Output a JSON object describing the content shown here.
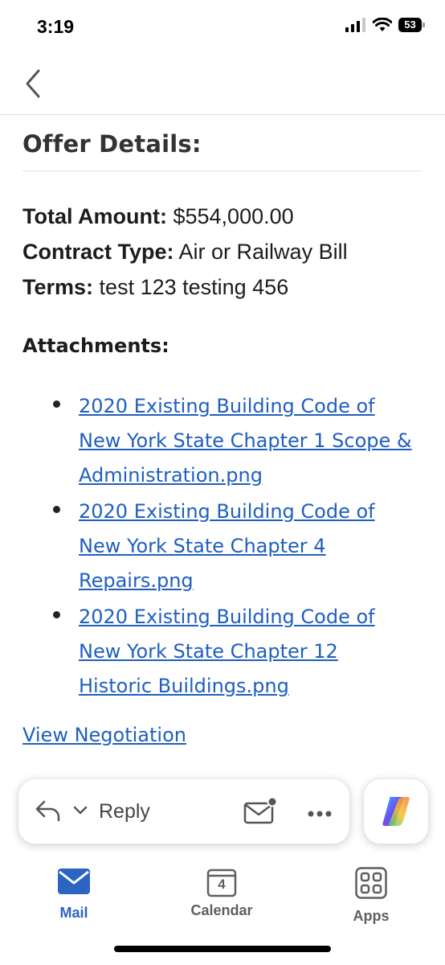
{
  "status_bar": {
    "time": "3:19",
    "battery": "53"
  },
  "offer": {
    "title": "Offer Details:",
    "total_label": "Total Amount:",
    "total_value": "$554,000.00",
    "contract_label": "Contract Type:",
    "contract_value": "Air or Railway Bill",
    "terms_label": "Terms:",
    "terms_value": "test 123 testing 456"
  },
  "attachments": {
    "title": "Attachments:",
    "items": [
      {
        "lines": [
          "2020 Existing Building Code of",
          "New York State Chapter 1 Scope &",
          "Administration.png"
        ]
      },
      {
        "lines": [
          "2020 Existing Building Code of",
          "New York State Chapter 4",
          "Repairs.png"
        ]
      },
      {
        "lines": [
          "2020 Existing Building Code of",
          "New York State Chapter 12",
          "Historic Buildings.png"
        ]
      }
    ]
  },
  "view_negotiation": "View Negotiation",
  "reply_bar": {
    "reply_label": "Reply"
  },
  "tabs": [
    {
      "label": "Mail",
      "icon": "mail-icon",
      "active": true
    },
    {
      "label": "Calendar",
      "icon": "calendar-icon",
      "date": "4",
      "active": false
    },
    {
      "label": "Apps",
      "icon": "apps-icon",
      "active": false
    }
  ],
  "colors": {
    "link": "#1f5fbf",
    "active_tab": "#2b65c4",
    "inactive_tab": "#5f5f5f"
  }
}
